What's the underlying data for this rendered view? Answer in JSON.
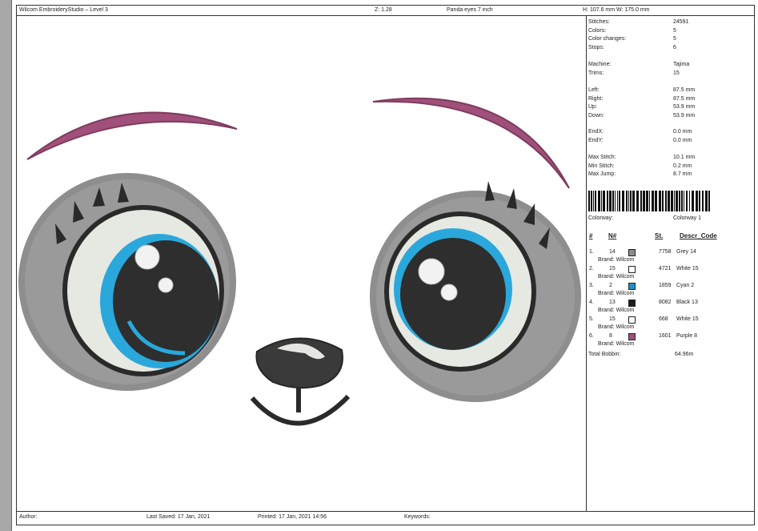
{
  "title_bar": {
    "app": "Wilcom EmbroideryStudio – Level 3",
    "zoom": "Z: 1.28",
    "design_name": "Panda eyes 7 inch",
    "size": "H: 107.6 mm   W: 175.0 mm"
  },
  "stats": [
    {
      "label": "Stitches:",
      "value": "24591"
    },
    {
      "label": "Colors:",
      "value": "5"
    },
    {
      "label": "Color changes:",
      "value": "5"
    },
    {
      "label": "Stops:",
      "value": "6"
    },
    {
      "label": "Machine:",
      "value": "Tajima"
    },
    {
      "label": "Trims:",
      "value": "15"
    },
    {
      "label": "Left:",
      "value": "87.5 mm"
    },
    {
      "label": "Right:",
      "value": "87.5 mm"
    },
    {
      "label": "Up:",
      "value": "53.9 mm"
    },
    {
      "label": "Down:",
      "value": "53.9 mm"
    },
    {
      "label": "EndX:",
      "value": "0.0 mm"
    },
    {
      "label": "EndY:",
      "value": "0.0 mm"
    },
    {
      "label": "Max Stitch:",
      "value": "10.1 mm"
    },
    {
      "label": "Min Stitch:",
      "value": "0.2 mm"
    },
    {
      "label": "Max Jump:",
      "value": "8.7 mm"
    }
  ],
  "colorway": {
    "label": "Colorway:",
    "value": "Colorway 1"
  },
  "thread_headers": {
    "num": "#",
    "code": "N#",
    "stitches": "St.",
    "desc": "Descr_Code"
  },
  "threads": [
    {
      "num": "1.",
      "code": "14",
      "color": "#8c8c8c",
      "stitches": "7758",
      "desc": "Grey 14",
      "brand": "Brand: Wilcom"
    },
    {
      "num": "2.",
      "code": "15",
      "color": "#ffffff",
      "stitches": "4721",
      "desc": "White 15",
      "brand": "Brand: Wilcom"
    },
    {
      "num": "3.",
      "code": "2",
      "color": "#1e90d0",
      "stitches": "1859",
      "desc": "Cyan 2",
      "brand": "Brand: Wilcom"
    },
    {
      "num": "4.",
      "code": "13",
      "color": "#1e1e1e",
      "stitches": "8082",
      "desc": "Black 13",
      "brand": "Brand: Wilcom"
    },
    {
      "num": "5.",
      "code": "15",
      "color": "#ffffff",
      "stitches": "668",
      "desc": "White 15",
      "brand": "Brand: Wilcom"
    },
    {
      "num": "6.",
      "code": "8",
      "color": "#a0507a",
      "stitches": "1601",
      "desc": "Purple 8",
      "brand": "Brand: Wilcom"
    }
  ],
  "total_bobbin": {
    "label": "Total Bobbin:",
    "value": "64.96m"
  },
  "footer": {
    "author": "Author:",
    "last_saved": "Last Saved: 17 Jan, 2021",
    "printed": "Printed: 17 Jan, 2021 14:56",
    "keywords": "Keywords:"
  },
  "colors": {
    "grey_fill": "#8c8c8c",
    "eye_white": "#e6e9e2",
    "cyan": "#2aa8dc",
    "black": "#2a2a2a",
    "purple": "#a0507a"
  }
}
